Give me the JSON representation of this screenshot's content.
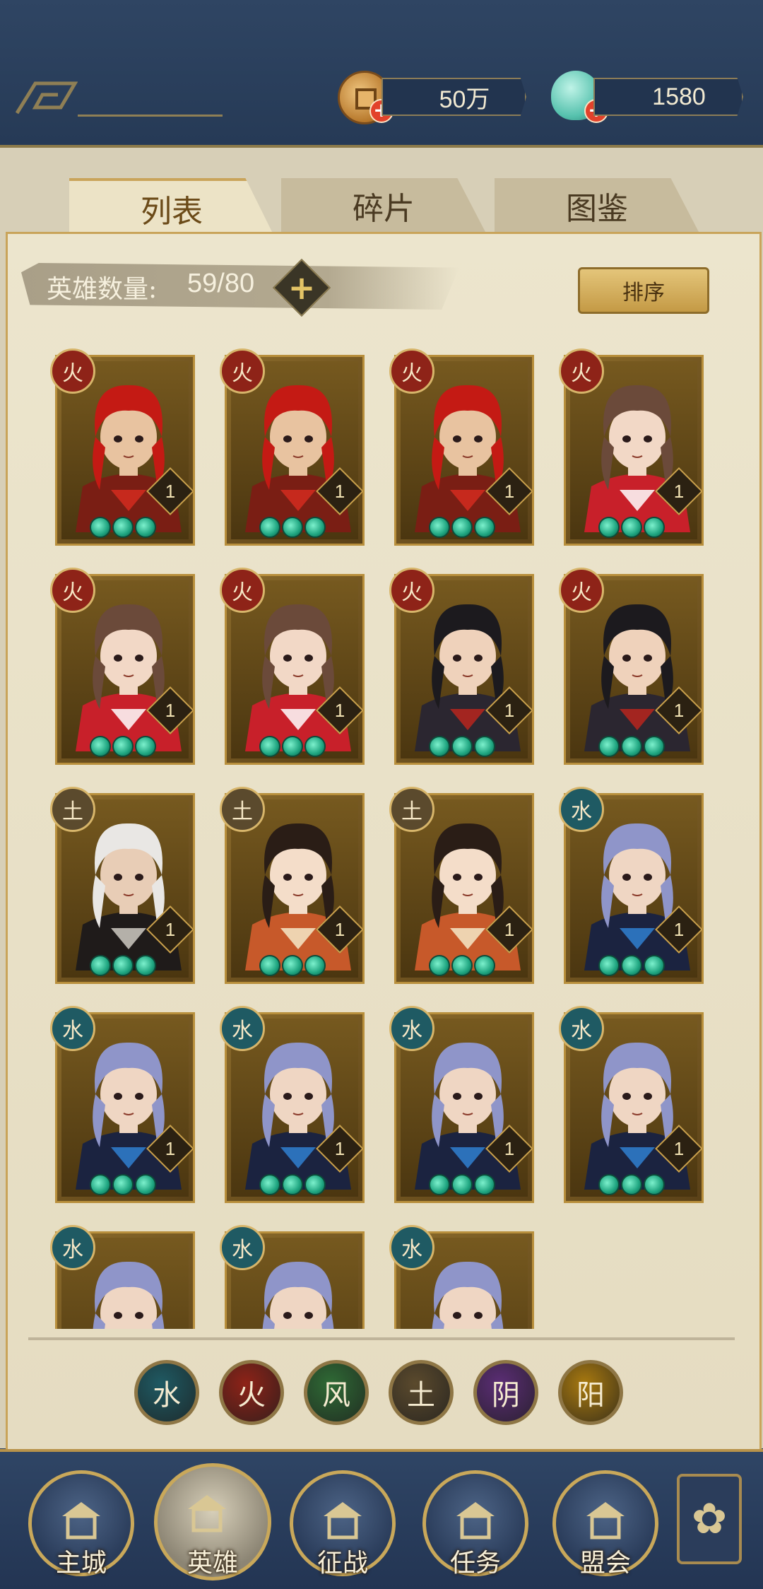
{
  "resources": {
    "coins": "50万",
    "shells": "1580"
  },
  "tabs": [
    {
      "label": "列表",
      "active": true
    },
    {
      "label": "碎片",
      "active": false
    },
    {
      "label": "图鉴",
      "active": false
    }
  ],
  "hero_count": {
    "label": "英雄数量:",
    "value": "59/80"
  },
  "sort_label": "排序",
  "element_colors": {
    "fire": "#8e2318",
    "earth": "#5b4a2d",
    "water": "#1f5a63"
  },
  "heroes": [
    {
      "element": "火",
      "type": "fire",
      "character": "red-hair",
      "level": "1",
      "stars": 3
    },
    {
      "element": "火",
      "type": "fire",
      "character": "red-hair",
      "level": "1",
      "stars": 3
    },
    {
      "element": "火",
      "type": "fire",
      "character": "red-hair",
      "level": "1",
      "stars": 3
    },
    {
      "element": "火",
      "type": "fire",
      "character": "red-dress-girl",
      "level": "1",
      "stars": 3
    },
    {
      "element": "火",
      "type": "fire",
      "character": "red-dress-girl",
      "level": "1",
      "stars": 3
    },
    {
      "element": "火",
      "type": "fire",
      "character": "red-dress-girl",
      "level": "1",
      "stars": 3
    },
    {
      "element": "火",
      "type": "fire",
      "character": "black-hair",
      "level": "1",
      "stars": 3
    },
    {
      "element": "火",
      "type": "fire",
      "character": "black-hair",
      "level": "1",
      "stars": 3
    },
    {
      "element": "土",
      "type": "earth",
      "character": "white-hair",
      "level": "1",
      "stars": 3
    },
    {
      "element": "土",
      "type": "earth",
      "character": "flower-girl",
      "level": "1",
      "stars": 3
    },
    {
      "element": "土",
      "type": "earth",
      "character": "flower-girl",
      "level": "1",
      "stars": 3
    },
    {
      "element": "水",
      "type": "water",
      "character": "silver-hair",
      "level": "1",
      "stars": 3
    },
    {
      "element": "水",
      "type": "water",
      "character": "silver-hair",
      "level": "1",
      "stars": 3
    },
    {
      "element": "水",
      "type": "water",
      "character": "silver-hair",
      "level": "1",
      "stars": 3
    },
    {
      "element": "水",
      "type": "water",
      "character": "silver-hair",
      "level": "1",
      "stars": 3
    },
    {
      "element": "水",
      "type": "water",
      "character": "silver-hair",
      "level": "1",
      "stars": 3
    },
    {
      "element": "水",
      "type": "water",
      "character": "silver-hair",
      "level": "",
      "stars": 0
    },
    {
      "element": "水",
      "type": "water",
      "character": "silver-hair",
      "level": "",
      "stars": 0
    },
    {
      "element": "水",
      "type": "water",
      "character": "silver-hair",
      "level": "",
      "stars": 0
    }
  ],
  "filters": [
    {
      "label": "水",
      "color": "#1f5a63"
    },
    {
      "label": "火",
      "color": "#8e2318"
    },
    {
      "label": "风",
      "color": "#2f6a35"
    },
    {
      "label": "土",
      "color": "#5b4a2d"
    },
    {
      "label": "阴",
      "color": "#5b2d75"
    },
    {
      "label": "阳",
      "color": "#a8790f"
    }
  ],
  "nav": [
    {
      "label": "主城",
      "icon": "castle-icon",
      "active": false
    },
    {
      "label": "英雄",
      "icon": "hero-icon",
      "active": true
    },
    {
      "label": "征战",
      "icon": "battle-icon",
      "active": false
    },
    {
      "label": "任务",
      "icon": "task-icon",
      "active": false
    },
    {
      "label": "盟会",
      "icon": "guild-icon",
      "active": false
    }
  ],
  "more_icon": "menu-icon"
}
